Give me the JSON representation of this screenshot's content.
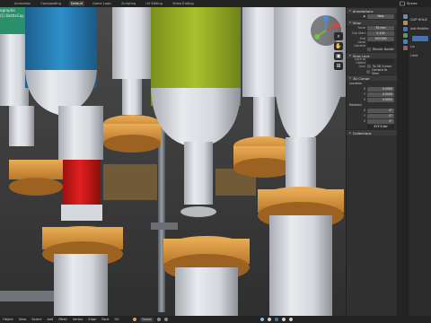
{
  "workspace_tabs": [
    "Animation",
    "Compositing",
    "Default",
    "Game Logic",
    "Scripting",
    "UV Editing",
    "Video Editing"
  ],
  "active_tab_index": 2,
  "scene_name": "Scene",
  "viewport": {
    "overlay_line1": "ographic",
    "overlay_line2": "(1) BottleCap"
  },
  "npanel": {
    "annotations": {
      "title": "Annotations",
      "new_button": "New"
    },
    "view": {
      "title": "View",
      "focal_label": "Focal",
      "focal_value": "35 mm",
      "clip_start_label": "Clip Start",
      "clip_start_value": "0.100",
      "clip_end_label": "End",
      "clip_end_value": "100.000",
      "local_camera_label": "Local Camera",
      "render_border_label": "Render Border",
      "lock_label": "Lock"
    },
    "view_lock": {
      "title": "View Lock",
      "lock_to_object_label": "Lock to Object",
      "lock_label": "Lock",
      "to_3d_cursor_label": "To 3D Cursor",
      "camera_to_view_label": "Camera to View"
    },
    "cursor": {
      "title": "3D Cursor",
      "location_label": "Location",
      "x_label": "X",
      "x_value": "0.0000",
      "y_label": "Y",
      "y_value": "0.0000",
      "z_label": "Z",
      "z_value": "0.0000",
      "rotation_label": "Rotation",
      "rx_label": "X",
      "rx_value": "0°",
      "ry_label": "Y",
      "ry_value": "0°",
      "rz_label": "Z",
      "rz_value": "0°",
      "mode_value": "XYZ Euler"
    },
    "collections": {
      "title": "Collections"
    }
  },
  "properties": {
    "obj_name": "CLIP HOLD",
    "modifier_label": "Add Modifier",
    "row3": "Lin",
    "row4": "Limit"
  },
  "status": {
    "menus": [
      "Object",
      "View",
      "Select",
      "Add",
      "Mesh",
      "Vertex",
      "Edge",
      "Face",
      "UV"
    ],
    "transform_label": "Global"
  },
  "colors": {
    "accent_blue": "#4772b3",
    "cap_blue": "#2a7fb8",
    "cap_green": "#9db528",
    "cap_red": "#cc1a1a",
    "bottle_white": "#dcdfe3",
    "orange_ring": "#d99a3c"
  }
}
